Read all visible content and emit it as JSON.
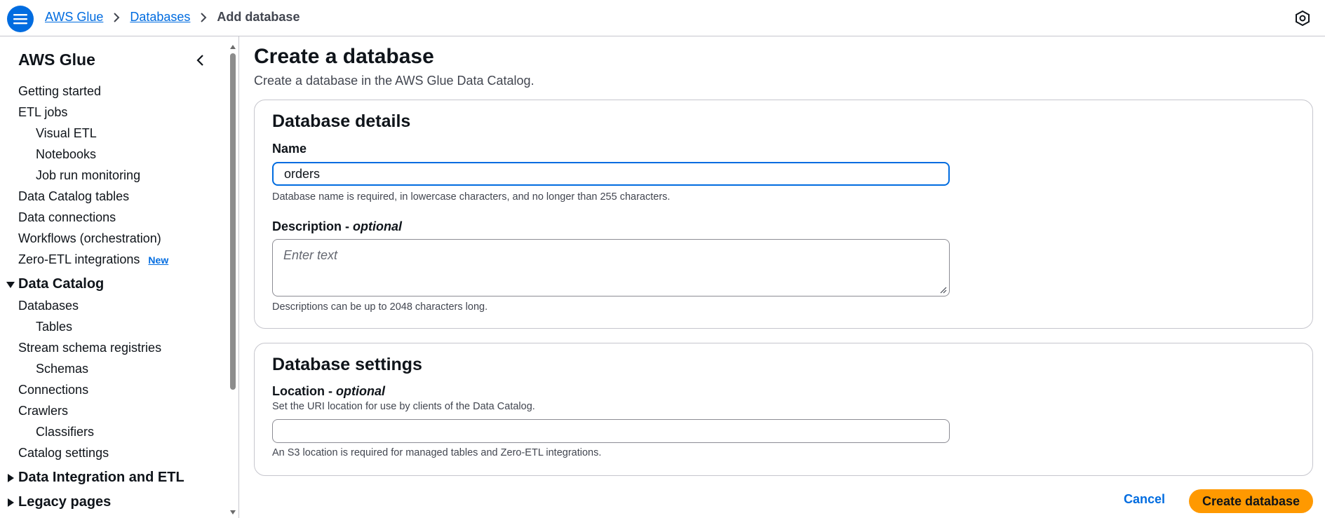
{
  "breadcrumb": {
    "items": [
      "AWS Glue",
      "Databases"
    ],
    "current": "Add database"
  },
  "sidebar": {
    "title": "AWS Glue",
    "items": [
      {
        "label": "Getting started"
      },
      {
        "label": "ETL jobs"
      },
      {
        "label": "Visual ETL"
      },
      {
        "label": "Notebooks"
      },
      {
        "label": "Job run monitoring"
      },
      {
        "label": "Data Catalog tables"
      },
      {
        "label": "Data connections"
      },
      {
        "label": "Workflows (orchestration)"
      },
      {
        "label": "Zero-ETL integrations",
        "badge": "New"
      }
    ],
    "sections": [
      {
        "label": "Data Catalog",
        "expanded": true
      },
      {
        "label": "Data Integration and ETL",
        "expanded": false
      },
      {
        "label": "Legacy pages",
        "expanded": false
      }
    ],
    "catalog_items": [
      {
        "label": "Databases"
      },
      {
        "label": "Tables"
      },
      {
        "label": "Stream schema registries"
      },
      {
        "label": "Schemas"
      },
      {
        "label": "Connections"
      },
      {
        "label": "Crawlers"
      },
      {
        "label": "Classifiers"
      },
      {
        "label": "Catalog settings"
      }
    ]
  },
  "page": {
    "title": "Create a database",
    "description": "Create a database in the AWS Glue Data Catalog."
  },
  "details": {
    "title": "Database details",
    "name_label": "Name",
    "name_value": "orders",
    "name_hint": "Database name is required, in lowercase characters, and no longer than 255 characters.",
    "desc_label": "Description - ",
    "desc_optional": "optional",
    "desc_placeholder": "Enter text",
    "desc_hint": "Descriptions can be up to 2048 characters long."
  },
  "settings": {
    "title": "Database settings",
    "location_label": "Location - ",
    "location_optional": "optional",
    "location_help": "Set the URI location for use by clients of the Data Catalog.",
    "location_value": "",
    "location_hint": "An S3 location is required for managed tables and Zero-ETL integrations."
  },
  "actions": {
    "cancel": "Cancel",
    "create": "Create database"
  },
  "colors": {
    "link": "#006ce0",
    "primary_button": "#ff9900",
    "border": "#c6c6cd"
  }
}
